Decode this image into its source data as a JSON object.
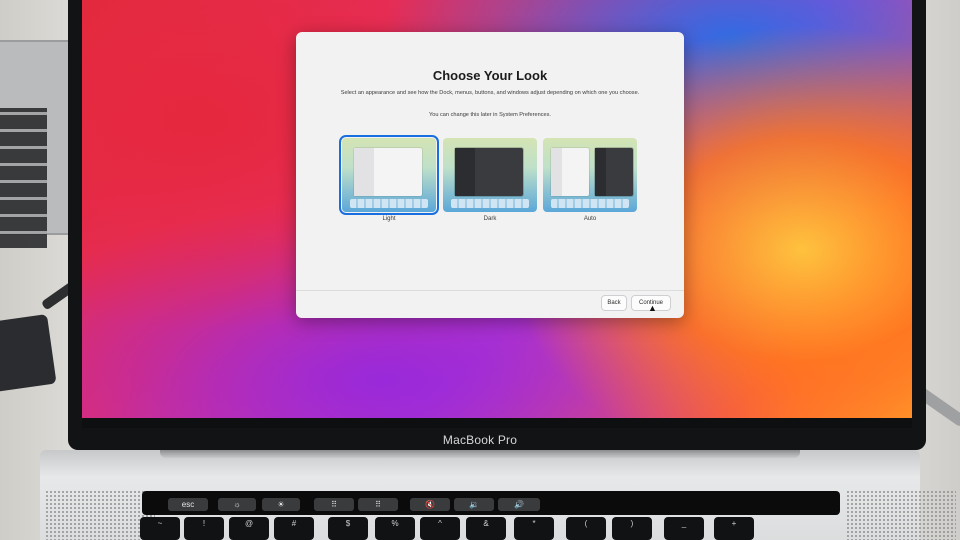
{
  "device": {
    "brand_label": "MacBook Pro"
  },
  "dialog": {
    "title": "Choose Your Look",
    "description": "Select an appearance and see how the Dock, menus, buttons, and windows adjust depending on which one you choose.",
    "note": "You can change this later in System Preferences.",
    "options": [
      {
        "label": "Light",
        "selected": true
      },
      {
        "label": "Dark",
        "selected": false
      },
      {
        "label": "Auto",
        "selected": false
      }
    ],
    "buttons": {
      "back": "Back",
      "continue": "Continue"
    }
  },
  "touch_bar": {
    "esc": "esc",
    "keys": [
      "☼",
      "☀",
      "⠿",
      "⠿",
      "🔇",
      "🔉",
      "🔊"
    ]
  },
  "keyboard": {
    "top_row": [
      "~",
      "!",
      "@",
      "#",
      "$",
      "%",
      "^",
      "&",
      "*",
      "(",
      ")",
      "_",
      "+"
    ]
  },
  "colors": {
    "selection_accent": "#1a6fe0",
    "dialog_bg": "#f2f2f3"
  }
}
